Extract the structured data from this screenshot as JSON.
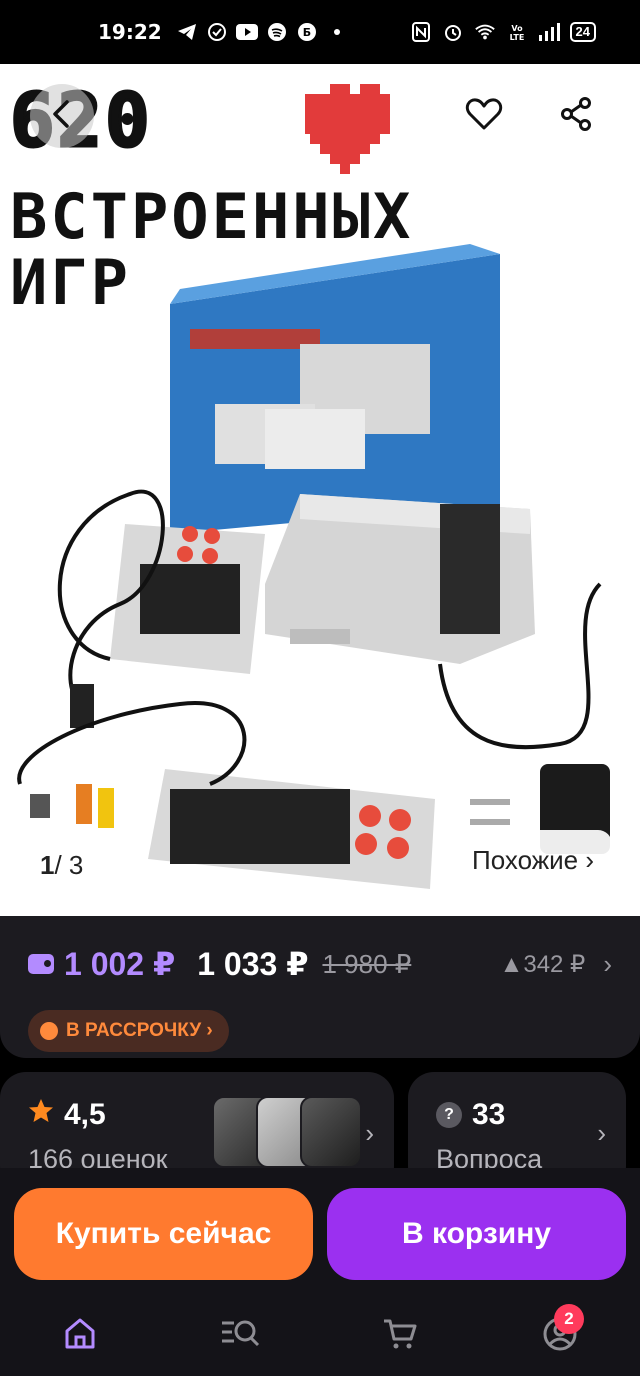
{
  "status_bar": {
    "time": "19:22",
    "battery": "24",
    "left_icons": [
      "telegram-icon",
      "check-circle-icon",
      "youtube-icon",
      "spotify-icon",
      "b-app-icon",
      "dot-icon"
    ],
    "right_icons": [
      "nfc-icon",
      "alarm-icon",
      "wifi-icon",
      "volte-icon",
      "signal-icon"
    ]
  },
  "gallery": {
    "pixel_number": "620",
    "pixel_word1": "ВСТРОЕННЫХ",
    "pixel_word2": "ИГР",
    "counter_current": "1",
    "counter_total": "/ 3",
    "similar_label": "Похожие ›"
  },
  "price": {
    "main": "1 002 ₽",
    "alt": "1 033 ₽",
    "old": "1 980 ₽",
    "delta": "▲342 ₽",
    "installment_label": "В РАССРОЧКУ ›"
  },
  "rating_card": {
    "value": "4,5",
    "count_label": "166 оценок"
  },
  "qa_card": {
    "value": "33",
    "label": "Вопроса"
  },
  "actions": {
    "buy_now": "Купить сейчас",
    "add_to_cart": "В корзину"
  },
  "nav": {
    "profile_badge": "2"
  },
  "colors": {
    "accent_purple": "#b38bff",
    "buy_orange": "#ff7a2f",
    "cart_purple": "#9b30f0",
    "installment_orange": "#ff8a3c",
    "badge_red": "#ff3b5c"
  }
}
